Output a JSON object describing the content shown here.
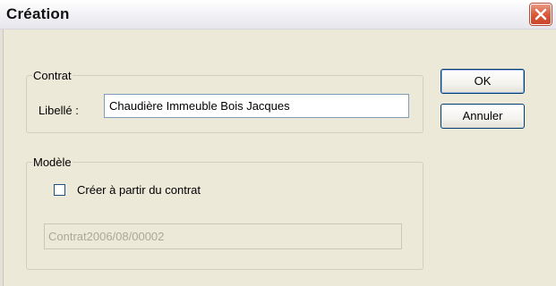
{
  "window": {
    "title": "Création"
  },
  "contrat_group": {
    "legend": "Contrat",
    "libelle_label": "Libellé :",
    "libelle_value": "Chaudière Immeuble Bois Jacques"
  },
  "modele_group": {
    "legend": "Modèle",
    "checkbox_label": "Créer à partir du contrat",
    "checkbox_checked": false,
    "contract_value": "Contrat2006/08/00002"
  },
  "buttons": {
    "ok_label": "OK",
    "cancel_label": "Annuler"
  },
  "colors": {
    "dialog_bg": "#ECE9D8",
    "close_button": "#D95A3A",
    "button_border": "#003C74",
    "disabled_text": "#ACA899"
  },
  "icons": {
    "close": "close-icon"
  }
}
